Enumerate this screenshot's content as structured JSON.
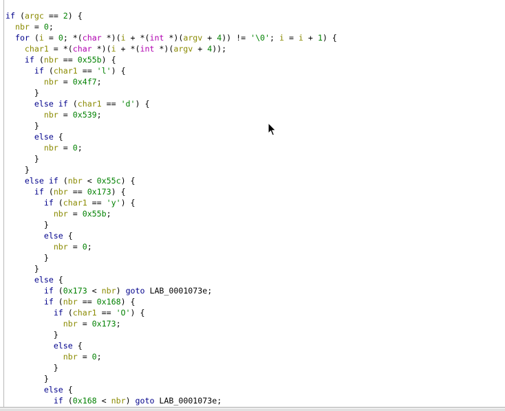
{
  "colors": {
    "keyword": "#00008b",
    "variable": "#8a8a00",
    "number": "#008000",
    "string": "#008000",
    "type": "#b000b0",
    "plain": "#000000",
    "background": "#ffffff"
  },
  "code_lines": [
    [
      [
        "kw",
        "if"
      ],
      [
        "p",
        " ("
      ],
      [
        "v",
        "argc"
      ],
      [
        "p",
        " == "
      ],
      [
        "n",
        "2"
      ],
      [
        "p",
        ") {"
      ]
    ],
    [
      [
        "p",
        "  "
      ],
      [
        "v",
        "nbr"
      ],
      [
        "p",
        " = "
      ],
      [
        "n",
        "0"
      ],
      [
        "p",
        ";"
      ]
    ],
    [
      [
        "p",
        "  "
      ],
      [
        "kw",
        "for"
      ],
      [
        "p",
        " ("
      ],
      [
        "v",
        "i"
      ],
      [
        "p",
        " = "
      ],
      [
        "n",
        "0"
      ],
      [
        "p",
        "; *("
      ],
      [
        "t",
        "char"
      ],
      [
        "p",
        " *)("
      ],
      [
        "v",
        "i"
      ],
      [
        "p",
        " + *("
      ],
      [
        "t",
        "int"
      ],
      [
        "p",
        " *)("
      ],
      [
        "v",
        "argv"
      ],
      [
        "p",
        " + "
      ],
      [
        "n",
        "4"
      ],
      [
        "p",
        ")) != "
      ],
      [
        "s",
        "'\\0'"
      ],
      [
        "p",
        "; "
      ],
      [
        "v",
        "i"
      ],
      [
        "p",
        " = "
      ],
      [
        "v",
        "i"
      ],
      [
        "p",
        " + "
      ],
      [
        "n",
        "1"
      ],
      [
        "p",
        ") {"
      ]
    ],
    [
      [
        "p",
        "    "
      ],
      [
        "v",
        "char1"
      ],
      [
        "p",
        " = *("
      ],
      [
        "t",
        "char"
      ],
      [
        "p",
        " *)("
      ],
      [
        "v",
        "i"
      ],
      [
        "p",
        " + *("
      ],
      [
        "t",
        "int"
      ],
      [
        "p",
        " *)("
      ],
      [
        "v",
        "argv"
      ],
      [
        "p",
        " + "
      ],
      [
        "n",
        "4"
      ],
      [
        "p",
        "));"
      ]
    ],
    [
      [
        "p",
        "    "
      ],
      [
        "kw",
        "if"
      ],
      [
        "p",
        " ("
      ],
      [
        "v",
        "nbr"
      ],
      [
        "p",
        " == "
      ],
      [
        "n",
        "0x55b"
      ],
      [
        "p",
        ") {"
      ]
    ],
    [
      [
        "p",
        "      "
      ],
      [
        "kw",
        "if"
      ],
      [
        "p",
        " ("
      ],
      [
        "v",
        "char1"
      ],
      [
        "p",
        " == "
      ],
      [
        "s",
        "'l'"
      ],
      [
        "p",
        ") {"
      ]
    ],
    [
      [
        "p",
        "        "
      ],
      [
        "v",
        "nbr"
      ],
      [
        "p",
        " = "
      ],
      [
        "n",
        "0x4f7"
      ],
      [
        "p",
        ";"
      ]
    ],
    [
      [
        "p",
        "      }"
      ]
    ],
    [
      [
        "p",
        "      "
      ],
      [
        "kw",
        "else if"
      ],
      [
        "p",
        " ("
      ],
      [
        "v",
        "char1"
      ],
      [
        "p",
        " == "
      ],
      [
        "s",
        "'d'"
      ],
      [
        "p",
        ") {"
      ]
    ],
    [
      [
        "p",
        "        "
      ],
      [
        "v",
        "nbr"
      ],
      [
        "p",
        " = "
      ],
      [
        "n",
        "0x539"
      ],
      [
        "p",
        ";"
      ]
    ],
    [
      [
        "p",
        "      }"
      ]
    ],
    [
      [
        "p",
        "      "
      ],
      [
        "kw",
        "else"
      ],
      [
        "p",
        " {"
      ]
    ],
    [
      [
        "p",
        "        "
      ],
      [
        "v",
        "nbr"
      ],
      [
        "p",
        " = "
      ],
      [
        "n",
        "0"
      ],
      [
        "p",
        ";"
      ]
    ],
    [
      [
        "p",
        "      }"
      ]
    ],
    [
      [
        "p",
        "    }"
      ]
    ],
    [
      [
        "p",
        "    "
      ],
      [
        "kw",
        "else if"
      ],
      [
        "p",
        " ("
      ],
      [
        "v",
        "nbr"
      ],
      [
        "p",
        " < "
      ],
      [
        "n",
        "0x55c"
      ],
      [
        "p",
        ") {"
      ]
    ],
    [
      [
        "p",
        "      "
      ],
      [
        "kw",
        "if"
      ],
      [
        "p",
        " ("
      ],
      [
        "v",
        "nbr"
      ],
      [
        "p",
        " == "
      ],
      [
        "n",
        "0x173"
      ],
      [
        "p",
        ") {"
      ]
    ],
    [
      [
        "p",
        "        "
      ],
      [
        "kw",
        "if"
      ],
      [
        "p",
        " ("
      ],
      [
        "v",
        "char1"
      ],
      [
        "p",
        " == "
      ],
      [
        "s",
        "'y'"
      ],
      [
        "p",
        ") {"
      ]
    ],
    [
      [
        "p",
        "          "
      ],
      [
        "v",
        "nbr"
      ],
      [
        "p",
        " = "
      ],
      [
        "n",
        "0x55b"
      ],
      [
        "p",
        ";"
      ]
    ],
    [
      [
        "p",
        "        }"
      ]
    ],
    [
      [
        "p",
        "        "
      ],
      [
        "kw",
        "else"
      ],
      [
        "p",
        " {"
      ]
    ],
    [
      [
        "p",
        "          "
      ],
      [
        "v",
        "nbr"
      ],
      [
        "p",
        " = "
      ],
      [
        "n",
        "0"
      ],
      [
        "p",
        ";"
      ]
    ],
    [
      [
        "p",
        "        }"
      ]
    ],
    [
      [
        "p",
        "      }"
      ]
    ],
    [
      [
        "p",
        "      "
      ],
      [
        "kw",
        "else"
      ],
      [
        "p",
        " {"
      ]
    ],
    [
      [
        "p",
        "        "
      ],
      [
        "kw",
        "if"
      ],
      [
        "p",
        " ("
      ],
      [
        "n",
        "0x173"
      ],
      [
        "p",
        " < "
      ],
      [
        "v",
        "nbr"
      ],
      [
        "p",
        ") "
      ],
      [
        "kw",
        "goto"
      ],
      [
        "p",
        " LAB_0001073e;"
      ]
    ],
    [
      [
        "p",
        "        "
      ],
      [
        "kw",
        "if"
      ],
      [
        "p",
        " ("
      ],
      [
        "v",
        "nbr"
      ],
      [
        "p",
        " == "
      ],
      [
        "n",
        "0x168"
      ],
      [
        "p",
        ") {"
      ]
    ],
    [
      [
        "p",
        "          "
      ],
      [
        "kw",
        "if"
      ],
      [
        "p",
        " ("
      ],
      [
        "v",
        "char1"
      ],
      [
        "p",
        " == "
      ],
      [
        "s",
        "'O'"
      ],
      [
        "p",
        ") {"
      ]
    ],
    [
      [
        "p",
        "            "
      ],
      [
        "v",
        "nbr"
      ],
      [
        "p",
        " = "
      ],
      [
        "n",
        "0x173"
      ],
      [
        "p",
        ";"
      ]
    ],
    [
      [
        "p",
        "          }"
      ]
    ],
    [
      [
        "p",
        "          "
      ],
      [
        "kw",
        "else"
      ],
      [
        "p",
        " {"
      ]
    ],
    [
      [
        "p",
        "            "
      ],
      [
        "v",
        "nbr"
      ],
      [
        "p",
        " = "
      ],
      [
        "n",
        "0"
      ],
      [
        "p",
        ";"
      ]
    ],
    [
      [
        "p",
        "          }"
      ]
    ],
    [
      [
        "p",
        "        }"
      ]
    ],
    [
      [
        "p",
        "        "
      ],
      [
        "kw",
        "else"
      ],
      [
        "p",
        " {"
      ]
    ],
    [
      [
        "p",
        "          "
      ],
      [
        "kw",
        "if"
      ],
      [
        "p",
        " ("
      ],
      [
        "n",
        "0x168"
      ],
      [
        "p",
        " < "
      ],
      [
        "v",
        "nbr"
      ],
      [
        "p",
        ") "
      ],
      [
        "kw",
        "goto"
      ],
      [
        "p",
        " LAB_0001073e;"
      ]
    ]
  ],
  "cursor": "arrow-cursor-icon"
}
